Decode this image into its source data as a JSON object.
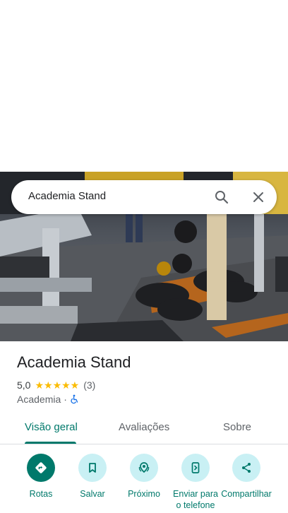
{
  "search": {
    "query": "Academia Stand"
  },
  "place": {
    "name": "Academia Stand",
    "rating": "5,0",
    "stars": "★★★★★",
    "review_count": "(3)",
    "category": "Academia",
    "separator": "·"
  },
  "tabs": [
    {
      "label": "Visão geral",
      "active": true
    },
    {
      "label": "Avaliações",
      "active": false
    },
    {
      "label": "Sobre",
      "active": false
    }
  ],
  "actions": [
    {
      "label": "Rotas",
      "icon": "directions-icon"
    },
    {
      "label": "Salvar",
      "icon": "bookmark-icon"
    },
    {
      "label": "Próximo",
      "icon": "nearby-icon"
    },
    {
      "label": "Enviar para o telefone",
      "icon": "send-to-phone-icon"
    },
    {
      "label": "Compartilhar",
      "icon": "share-icon"
    }
  ],
  "colors": {
    "accent": "#00796b",
    "action_bg": "#c9f0f4",
    "star": "#fbbc04"
  }
}
